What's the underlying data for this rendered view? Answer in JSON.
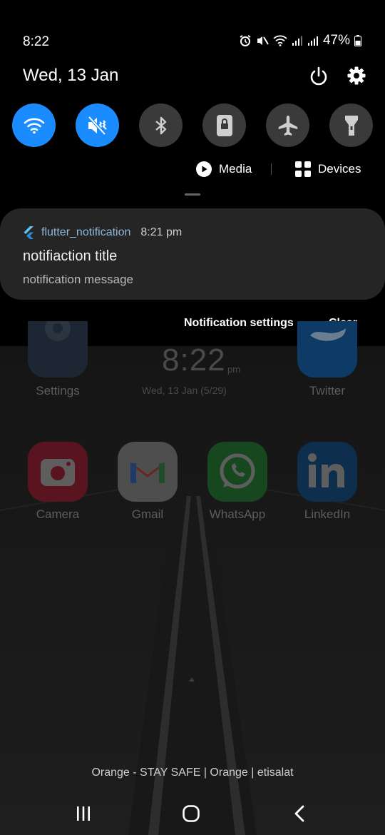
{
  "status_bar": {
    "time": "8:22",
    "battery_percent": "47%",
    "icons": [
      "alarm-icon",
      "mute-icon",
      "wifi-icon",
      "signal-icon",
      "signal-icon",
      "battery-icon"
    ]
  },
  "header": {
    "date": "Wed, 13 Jan",
    "icons": [
      "power-icon",
      "settings-gear-icon"
    ]
  },
  "quick_tiles": [
    {
      "icon": "wifi-icon",
      "active": true
    },
    {
      "icon": "mute-vibrate-icon",
      "active": true
    },
    {
      "icon": "bluetooth-icon",
      "active": false
    },
    {
      "icon": "portrait-lock-icon",
      "active": false
    },
    {
      "icon": "airplane-icon",
      "active": false
    },
    {
      "icon": "flashlight-icon",
      "active": false
    }
  ],
  "media": {
    "media_label": "Media",
    "devices_label": "Devices"
  },
  "notification": {
    "app_name": "flutter_notification",
    "time": "8:21 pm",
    "title": "notifiaction title",
    "message": "notification message"
  },
  "notification_actions": {
    "settings_label": "Notification settings",
    "clear_label": "Clear"
  },
  "home_screen": {
    "clock": "8:22",
    "clock_suffix": "pm",
    "clock_date": "Wed, 13 Jan (5/29)",
    "apps": [
      {
        "label": "Settings"
      },
      {
        "label": "Twitter"
      },
      {
        "label": "Camera"
      },
      {
        "label": "Gmail"
      },
      {
        "label": "WhatsApp"
      },
      {
        "label": "LinkedIn"
      }
    ]
  },
  "carrier_text": "Orange - STAY SAFE | Orange | etisalat",
  "colors": {
    "accent": "#1a8cff",
    "tile_off": "#3a3a3a",
    "card": "#252525"
  }
}
